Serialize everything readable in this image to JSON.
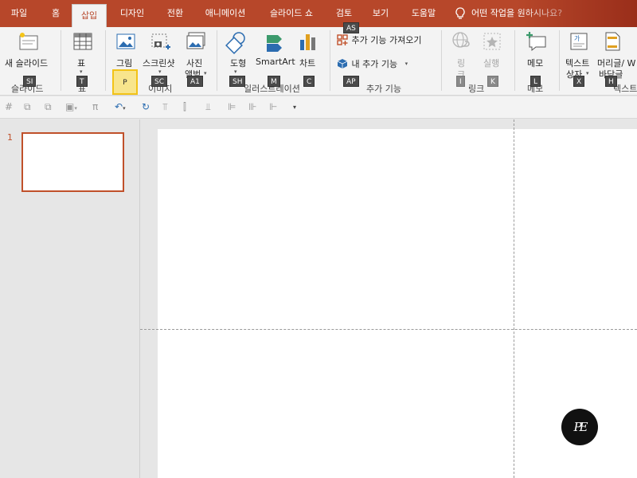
{
  "tabs": [
    {
      "label": "파일"
    },
    {
      "label": "홈"
    },
    {
      "label": "삽입"
    },
    {
      "label": "디자인"
    },
    {
      "label": "전환"
    },
    {
      "label": "애니메이션"
    },
    {
      "label": "슬라이드 쇼"
    },
    {
      "label": "검토"
    },
    {
      "label": "보기"
    },
    {
      "label": "도움말"
    }
  ],
  "tell_me": "어떤 작업을 원하시나요?",
  "ribbon": {
    "new_slide": "새 슬라이드",
    "table": "표",
    "picture": "그림",
    "screenshot": "스크린샷",
    "album_1": "사진",
    "album_2": "앨범",
    "shape": "도형",
    "smartart": "SmartArt",
    "chart": "차트",
    "get_addins": "추가 기능 가져오기",
    "my_addins": "내 추가 기능",
    "link_1": "링",
    "link_2": "크",
    "action": "실행",
    "comment": "메모",
    "textbox_1": "텍스트",
    "textbox_2": "상자",
    "header_1": "머리글/ W",
    "header_2": "바닥글",
    "groups": {
      "slides": "슬라이드",
      "tables": "표",
      "images": "이미지",
      "illustrations": "일러스트레이션",
      "addins": "추가 기능",
      "links": "링크",
      "comments": "메모",
      "text": "텍스트"
    }
  },
  "keytips": {
    "si": "SI",
    "t": "T",
    "p": "P",
    "sc": "SC",
    "a1": "A1",
    "sh": "SH",
    "m": "M",
    "c": "C",
    "as": "AS",
    "ap": "AP",
    "i": "I",
    "k": "K",
    "l": "L",
    "x": "X",
    "h": "H"
  },
  "qat": {
    "pi": "π"
  },
  "slides_panel": {
    "number": "1"
  },
  "logo_text": "PE",
  "colors": {
    "accent": "#b7472a",
    "ribbon_bg": "#f3f3f3",
    "keytip_highlight": "#f8e58c"
  }
}
